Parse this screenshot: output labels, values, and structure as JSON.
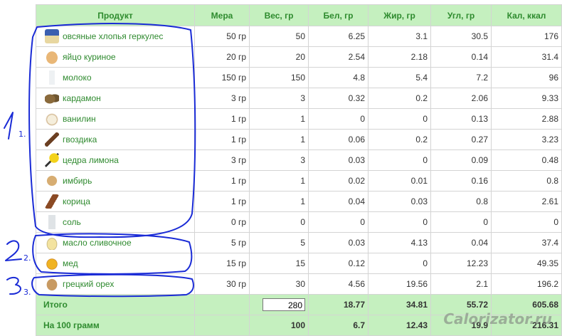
{
  "headers": [
    "Продукт",
    "Мера",
    "Вес, гр",
    "Бел, гр",
    "Жир, гр",
    "Угл, гр",
    "Кал, ккал"
  ],
  "rows": [
    {
      "icon": "oat-flakes-icon",
      "icls": "ico-oats",
      "name": "овсяные хлопья геркулес",
      "measure": "50 гр",
      "weight": "50",
      "protein": "6.25",
      "fat": "3.1",
      "carbs": "30.5",
      "kcal": "176"
    },
    {
      "icon": "egg-icon",
      "icls": "ico-egg",
      "name": "яйцо куриное",
      "measure": "20 гр",
      "weight": "20",
      "protein": "2.54",
      "fat": "2.18",
      "carbs": "0.14",
      "kcal": "31.4"
    },
    {
      "icon": "milk-icon",
      "icls": "ico-milk",
      "name": "молоко",
      "measure": "150 гр",
      "weight": "150",
      "protein": "4.8",
      "fat": "5.4",
      "carbs": "7.2",
      "kcal": "96"
    },
    {
      "icon": "cardamom-icon",
      "icls": "ico-cardamom",
      "name": "кардамон",
      "measure": "3 гр",
      "weight": "3",
      "protein": "0.32",
      "fat": "0.2",
      "carbs": "2.06",
      "kcal": "9.33"
    },
    {
      "icon": "vanilla-icon",
      "icls": "ico-vanilla",
      "name": "ванилин",
      "measure": "1 гр",
      "weight": "1",
      "protein": "0",
      "fat": "0",
      "carbs": "0.13",
      "kcal": "2.88"
    },
    {
      "icon": "clove-icon",
      "icls": "ico-clove",
      "name": "гвоздика",
      "measure": "1 гр",
      "weight": "1",
      "protein": "0.06",
      "fat": "0.2",
      "carbs": "0.27",
      "kcal": "3.23"
    },
    {
      "icon": "lemon-zest-icon",
      "icls": "ico-lemon",
      "name": "цедра лимона",
      "measure": "3 гр",
      "weight": "3",
      "protein": "0.03",
      "fat": "0",
      "carbs": "0.09",
      "kcal": "0.48"
    },
    {
      "icon": "ginger-icon",
      "icls": "ico-ginger",
      "name": "имбирь",
      "measure": "1 гр",
      "weight": "1",
      "protein": "0.02",
      "fat": "0.01",
      "carbs": "0.16",
      "kcal": "0.8"
    },
    {
      "icon": "cinnamon-icon",
      "icls": "ico-cinnamon",
      "name": "корица",
      "measure": "1 гр",
      "weight": "1",
      "protein": "0.04",
      "fat": "0.03",
      "carbs": "0.8",
      "kcal": "2.61"
    },
    {
      "icon": "salt-icon",
      "icls": "ico-salt",
      "name": "соль",
      "measure": "0 гр",
      "weight": "0",
      "protein": "0",
      "fat": "0",
      "carbs": "0",
      "kcal": "0"
    },
    {
      "icon": "butter-icon",
      "icls": "ico-butter",
      "name": "масло сливочное",
      "measure": "5 гр",
      "weight": "5",
      "protein": "0.03",
      "fat": "4.13",
      "carbs": "0.04",
      "kcal": "37.4"
    },
    {
      "icon": "honey-icon",
      "icls": "ico-honey",
      "name": "мед",
      "measure": "15 гр",
      "weight": "15",
      "protein": "0.12",
      "fat": "0",
      "carbs": "12.23",
      "kcal": "49.35"
    },
    {
      "icon": "walnut-icon",
      "icls": "ico-walnut",
      "name": "грецкий орех",
      "measure": "30 гр",
      "weight": "30",
      "protein": "4.56",
      "fat": "19.56",
      "carbs": "2.1",
      "kcal": "196.2"
    }
  ],
  "total": {
    "label": "Итого",
    "weight": "280",
    "protein": "18.77",
    "fat": "34.81",
    "carbs": "55.72",
    "kcal": "605.68"
  },
  "per100": {
    "label": "На 100 грамм",
    "weight": "100",
    "protein": "6.7",
    "fat": "12.43",
    "carbs": "19.9",
    "kcal": "216.31"
  },
  "annotations": [
    "1.",
    "2.",
    "3."
  ],
  "watermark": "Calorizator.ru",
  "colors": {
    "header_bg": "#c5f0bf",
    "header_text": "#2e8b2e",
    "product_link": "#2f8a2f",
    "annotation_ink": "#1a2bd6"
  }
}
